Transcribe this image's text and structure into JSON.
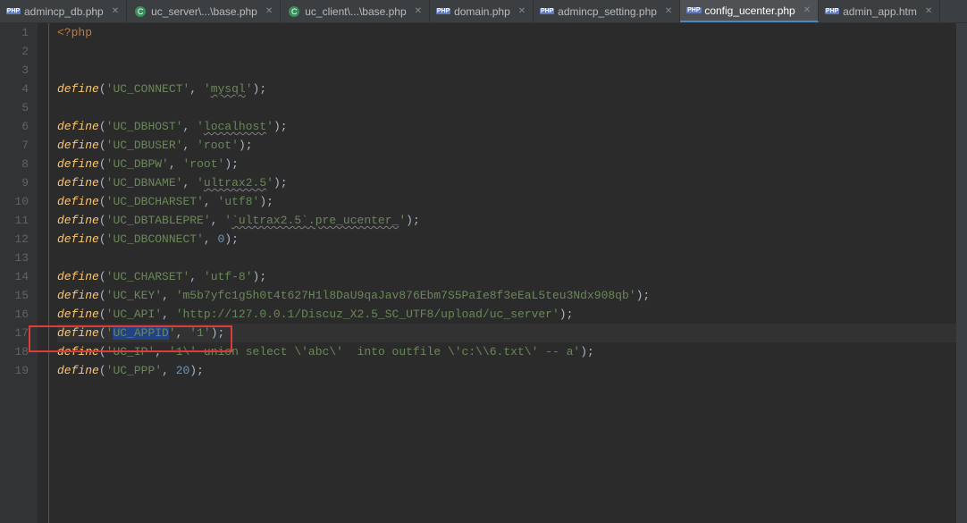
{
  "tabs": [
    {
      "label": "admincp_db.php",
      "icon": "php",
      "active": false
    },
    {
      "label": "uc_server\\...\\base.php",
      "icon": "c",
      "active": false
    },
    {
      "label": "uc_client\\...\\base.php",
      "icon": "c",
      "active": false
    },
    {
      "label": "domain.php",
      "icon": "php",
      "active": false
    },
    {
      "label": "admincp_setting.php",
      "icon": "php",
      "active": false
    },
    {
      "label": "config_ucenter.php",
      "icon": "php",
      "active": true
    },
    {
      "label": "admin_app.htm",
      "icon": "php",
      "active": false
    }
  ],
  "gutter": [
    "1",
    "2",
    "3",
    "4",
    "5",
    "6",
    "7",
    "8",
    "9",
    "10",
    "11",
    "12",
    "13",
    "14",
    "15",
    "16",
    "17",
    "18",
    "19"
  ],
  "code": {
    "l1_open": "<?php",
    "def": "define",
    "lp": "(",
    "rp": ")",
    "c": ",",
    "sc": ";",
    "sp": " ",
    "q": "'",
    "k4": "UC_CONNECT",
    "v4": "mysql",
    "k6": "UC_DBHOST",
    "v6": "localhost",
    "k7": "UC_DBUSER",
    "v7": "root",
    "k8": "UC_DBPW",
    "v8": "root",
    "k9": "UC_DBNAME",
    "v9": "ultrax2.5",
    "k10": "UC_DBCHARSET",
    "v10": "utf8",
    "k11": "UC_DBTABLEPRE",
    "v11": "`ultrax2.5`.pre_ucenter_",
    "k12": "UC_DBCONNECT",
    "v12": "0",
    "k14": "UC_CHARSET",
    "v14": "utf-8",
    "k15": "UC_KEY",
    "v15": "m5b7yfc1g5h0t4t627H1l8DaU9qaJav876Ebm7S5PaIe8f3eEaL5teu3Ndx908qb",
    "k16": "UC_API",
    "v16": "http://127.0.0.1/Discuz_X2.5_SC_UTF8/upload/uc_server",
    "k17": "UC_APPID",
    "v17": "1",
    "k18": "UC_IP",
    "v18": "1\\' union select \\'abc\\'  into outfile \\'c:\\\\6.txt\\' -- a",
    "k19": "UC_PPP",
    "v19": "20"
  }
}
